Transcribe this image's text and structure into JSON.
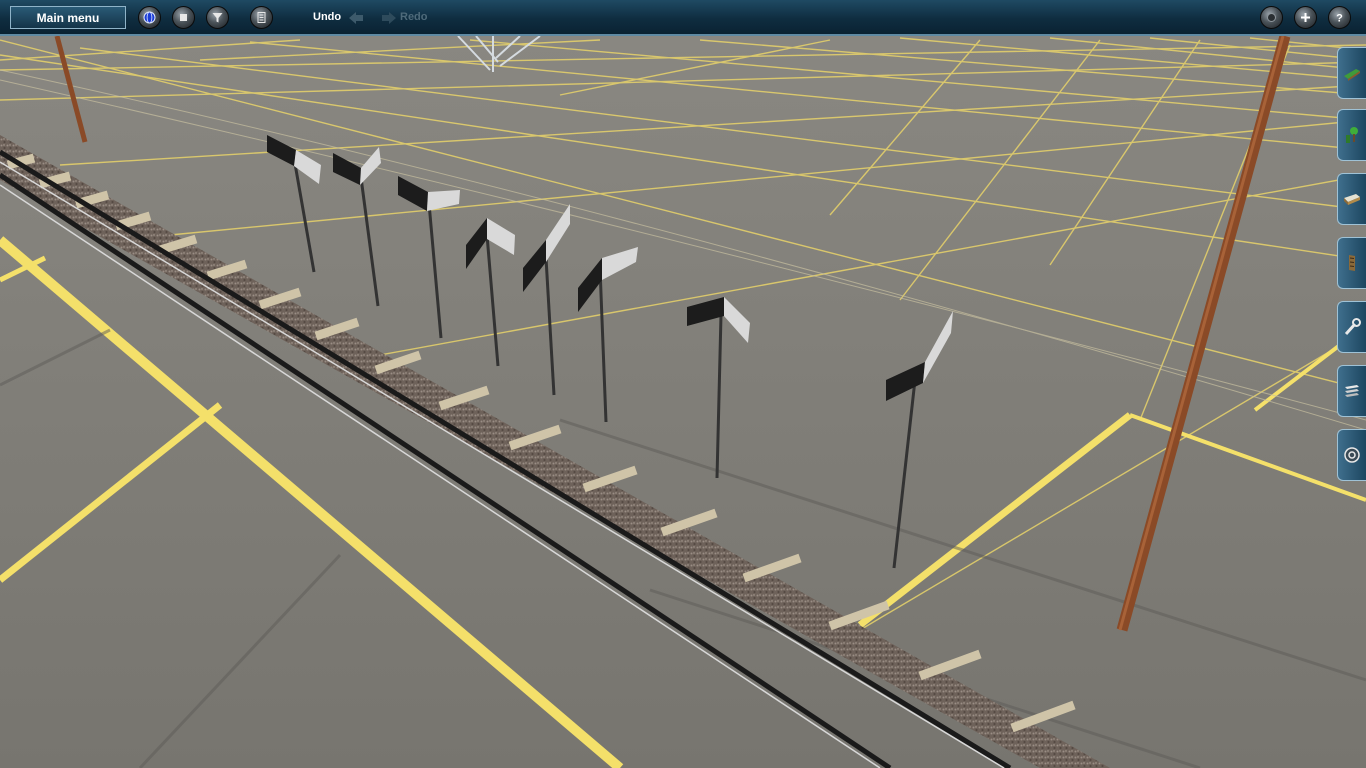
{
  "toolbar": {
    "main_menu_label": "Main menu",
    "undo_label": "Undo",
    "redo_label": "Redo",
    "left_buttons": [
      "globe-icon",
      "stop-icon",
      "filter-icon",
      "calculator-icon"
    ],
    "right_buttons": [
      "camera-icon",
      "plus-icon",
      "help-icon"
    ]
  },
  "side_tabs": [
    "track-laying-icon",
    "scenery-icon",
    "train-icon",
    "rail-vehicle-icon",
    "tools-icon",
    "layers-icon",
    "settings-icon"
  ],
  "colors": {
    "toolbar_bg": "#0f2d40",
    "grid_line": "#f2e06a",
    "ground": "#7d7b76",
    "pole": "#8a4a27"
  }
}
